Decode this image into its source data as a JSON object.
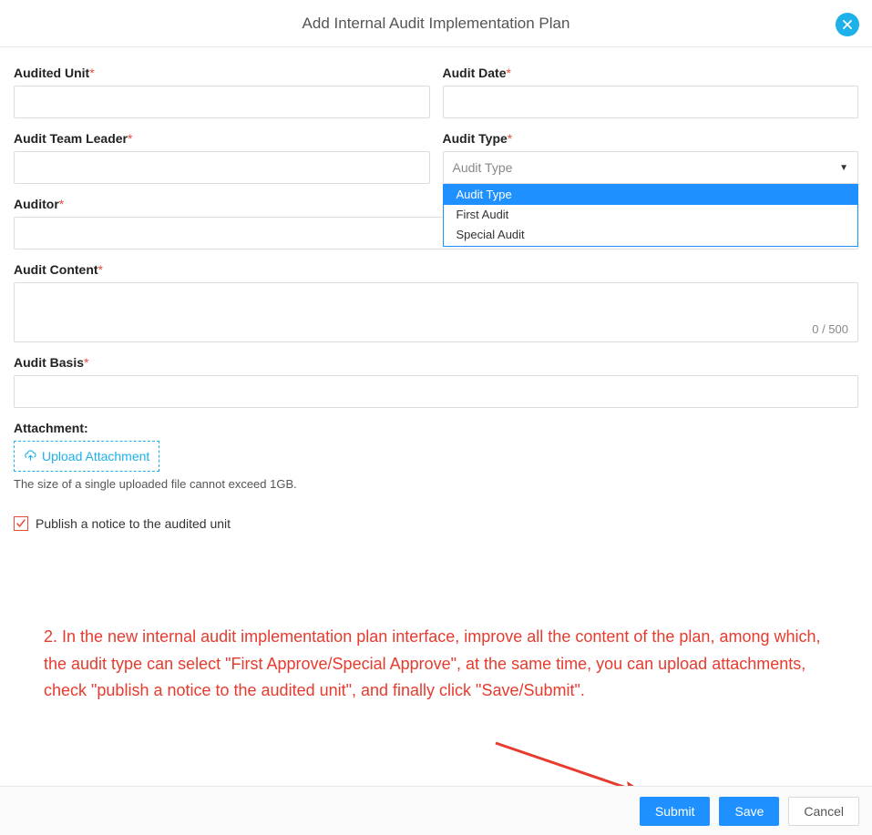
{
  "header": {
    "title": "Add Internal Audit Implementation Plan"
  },
  "fields": {
    "audited_unit": {
      "label": "Audited Unit",
      "value": ""
    },
    "audit_date": {
      "label": "Audit Date",
      "value": ""
    },
    "team_leader": {
      "label": "Audit Team Leader",
      "value": ""
    },
    "audit_type": {
      "label": "Audit Type",
      "placeholder": "Audit Type",
      "options": [
        "Audit Type",
        "First Audit",
        "Special Audit"
      ],
      "selected_index": 0
    },
    "auditor": {
      "label": "Auditor",
      "value": ""
    },
    "audit_content": {
      "label": "Audit Content",
      "value": "",
      "counter": "0 / 500"
    },
    "audit_basis": {
      "label": "Audit Basis",
      "value": ""
    }
  },
  "attachment": {
    "label": "Attachment:",
    "button": "Upload Attachment",
    "hint": "The size of a single uploaded file cannot exceed 1GB."
  },
  "publish": {
    "label": "Publish a notice to the audited unit",
    "checked": true
  },
  "instruction": "2. In the new internal audit implementation plan interface, improve all the content of the plan, among which, the audit type can select \"First Approve/Special Approve\", at the same time, you can upload attachments, check \"publish a notice to the audited unit\", and finally click \"Save/Submit\".",
  "footer": {
    "submit": "Submit",
    "save": "Save",
    "cancel": "Cancel"
  },
  "colors": {
    "primary": "#1e90ff",
    "accent": "#1eb0e9",
    "danger": "#e74c3c",
    "annotation": "#e63b2e"
  }
}
